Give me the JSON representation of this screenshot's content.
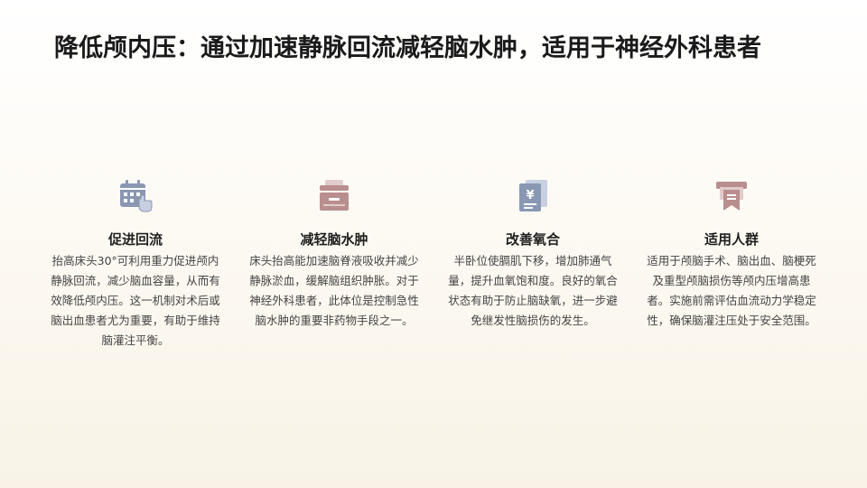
{
  "slide": {
    "title": "降低颅内压：通过加速静脉回流减轻脑水肿，适用于神经外科患者"
  },
  "cards": [
    {
      "icon": "calendar-hand-icon",
      "title": "促进回流",
      "body": "抬高床头30°可利用重力促进颅内静脉回流，减少脑血容量，从而有效降低颅内压。这一机制对术后或脑出血患者尤为重要，有助于维持脑灌注平衡。"
    },
    {
      "icon": "archive-box-icon",
      "title": "减轻脑水肿",
      "body": "床头抬高能加速脑脊液吸收并减少静脉淤血，缓解脑组织肿胀。对于神经外科患者，此体位是控制急性脑水肿的重要非药物手段之一。"
    },
    {
      "icon": "yuan-document-icon",
      "title": "改善氧合",
      "body": "半卧位使膈肌下移，增加肺通气量，提升血氧饱和度。良好的氧合状态有助于防止脑缺氧，进一步避免继发性脑损伤的发生。"
    },
    {
      "icon": "certificate-ribbon-icon",
      "title": "适用人群",
      "body": "适用于颅脑手术、脑出血、脑梗死及重型颅脑损伤等颅内压增高患者。实施前需评估血流动力学稳定性，确保脑灌注压处于安全范围。"
    }
  ],
  "colors": {
    "icon_blue": "#8a97b3",
    "icon_rose": "#b98e8e",
    "icon_blue_light": "#c7cfe0",
    "icon_rose_light": "#e2cccc"
  }
}
